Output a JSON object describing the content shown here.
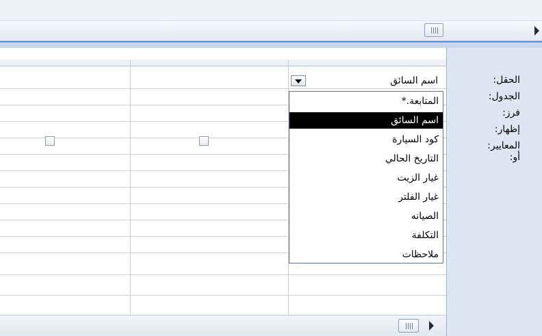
{
  "labels": {
    "field": "الحقل:",
    "table": "الجدول:",
    "sort": "فرز:",
    "show": "إظهار:",
    "criteria": "المعايير:",
    "or": "أو:"
  },
  "field_combo": {
    "value": "اسم السائق",
    "icon": "chevron-down-icon"
  },
  "dropdown": {
    "items": [
      "المتابعة.*",
      "اسم السائق",
      "كود السيارة",
      "التاريخ الحالي",
      "غيار الزيت",
      "غيار الفلتر",
      "الصيانه",
      "التكلفة",
      "ملاحظات"
    ],
    "selected_index": 1
  },
  "show_checkboxes": [
    {
      "checked": false
    },
    {
      "checked": false
    }
  ],
  "colors": {
    "label_pane": "#dde7f3",
    "accent_line": "#5f8dd1",
    "selection": "#000000"
  }
}
